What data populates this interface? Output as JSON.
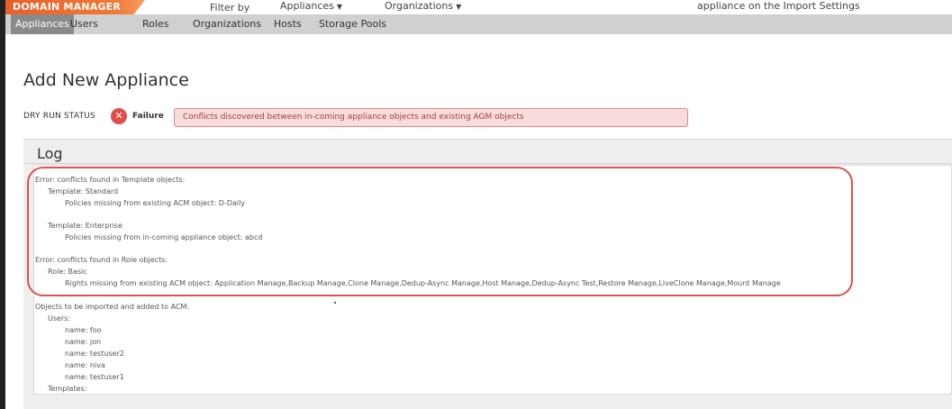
{
  "topbar": {
    "brand": "DOMAIN MANAGER",
    "filter_label": "Filter by",
    "filter_appliances": "Appliances",
    "filter_organizations": "Organizations",
    "trailing_text": "appliance on the Import Settings"
  },
  "nav": {
    "tabs": [
      {
        "label": "Appliances",
        "active": true
      },
      {
        "label": "Users",
        "active": false
      },
      {
        "label": "Roles",
        "active": false
      },
      {
        "label": "Organizations",
        "active": false
      },
      {
        "label": "Hosts",
        "active": false
      },
      {
        "label": "Storage Pools",
        "active": false
      }
    ]
  },
  "page": {
    "title": "Add New Appliance",
    "dry_run_label": "DRY RUN STATUS",
    "status_text": "Failure",
    "conflict_message": "Conflicts discovered between in-coming appliance objects and existing AGM objects"
  },
  "log": {
    "title": "Log",
    "lines": [
      "Error: conflicts found in Template objects:",
      "Template: Standard",
      "Policies missing from existing ACM object: D-Daily",
      "Template: Enterprise",
      "Policies missing from in-coming appliance object: abcd",
      "Error: conflicts found in Role objects:",
      "Role: Basic",
      "Rights missing from existing ACM object: Application Manage,Backup Manage,Clone Manage,Dedup-Async Manage,Host Manage,Dedup-Async Test,Restore Manage,LiveClone Manage,Mount Manage",
      "Objects to be imported and added to ACM:",
      "Users:",
      "name: foo",
      "name: jon",
      "name: testuser2",
      "name: niva",
      "name: testuser1",
      "Templates:"
    ]
  },
  "colors": {
    "brand_orange": "#e8602c",
    "failure_red": "#e24b4b",
    "conflict_bg": "#f8dcdc",
    "highlight_red": "#e05050"
  }
}
